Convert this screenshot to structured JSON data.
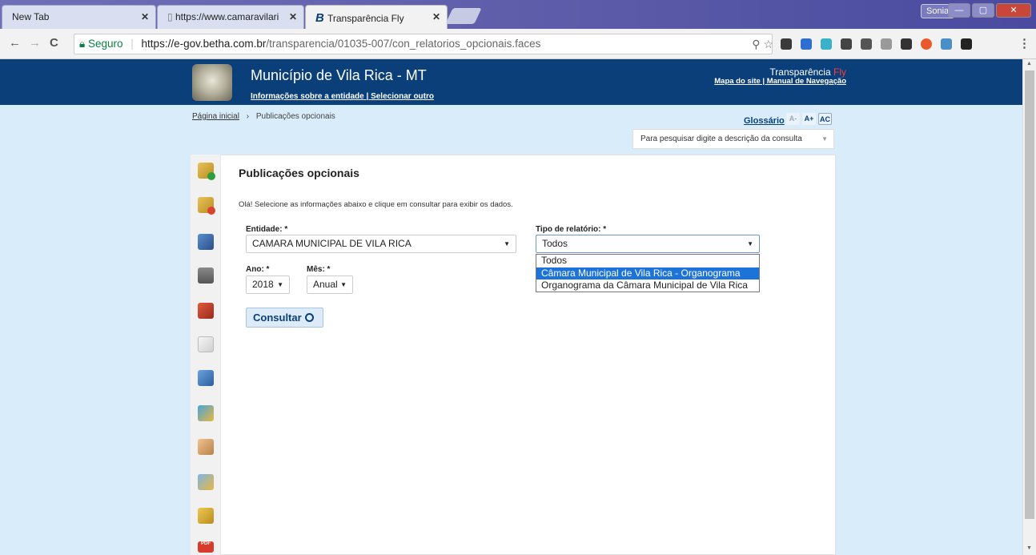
{
  "browser": {
    "tabs": [
      {
        "label": "New Tab"
      },
      {
        "label": "https://www.camaravilari"
      },
      {
        "label": "Transparência Fly"
      }
    ],
    "user": "Sonia",
    "nav": {
      "back": "←",
      "forward": "→",
      "reload": "C"
    },
    "address": {
      "secure_label": "Seguro",
      "url_main": "https://e-gov.betha.com.br",
      "url_tail": "/transparencia/01035-007/con_relatorios_opcionais.faces"
    }
  },
  "header": {
    "municipality": "Município de Vila Rica - MT",
    "info_link": "Informações sobre a entidade",
    "select_link": "Selecionar outro",
    "brand_name": "Transparência",
    "brand_fly": "Fly",
    "site_map": "Mapa do site",
    "manual": "Manual de Navegação"
  },
  "breadcrumb": {
    "home": "Página inicial",
    "sep": "›",
    "current": "Publicações opcionais"
  },
  "tools": {
    "glossary": "Glossário",
    "font_small": "A-",
    "font_big": "A+",
    "contrast": "AC"
  },
  "search": {
    "placeholder": "Para pesquisar digite a descrição da consulta"
  },
  "sidebar": {
    "icons": [
      "revenue-add-icon",
      "revenue-remove-icon",
      "truck-icon",
      "bank-icon",
      "boxes-icon",
      "document-sign-icon",
      "shopping-cart-icon",
      "report-icon",
      "people-icon",
      "spreadsheet-icon",
      "buildings-icon",
      "pdf-icon"
    ]
  },
  "form": {
    "title": "Publicações opcionais",
    "instructions": "Olá! Selecione as informações abaixo e clique em consultar para exibir os dados.",
    "entidade_label": "Entidade: *",
    "entidade_value": "CAMARA MUNICIPAL DE VILA RICA",
    "tipo_label": "Tipo de relatório: *",
    "tipo_value": "Todos",
    "tipo_options": [
      "Todos",
      "Câmara Municipal de Vila Rica - Organograma",
      "Organograma da Câmara Municipal de Vila Rica"
    ],
    "tipo_highlighted_index": 1,
    "ano_label": "Ano: *",
    "ano_value": "2018",
    "mes_label": "Mês: *",
    "mes_value": "Anual",
    "submit_label": "Consultar"
  }
}
